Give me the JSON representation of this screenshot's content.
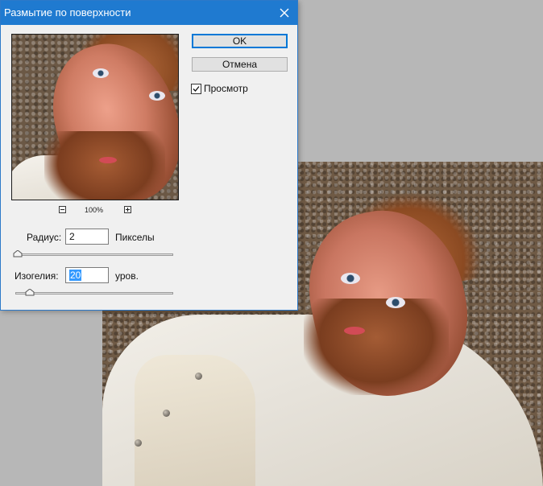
{
  "dialog": {
    "title": "Размытие по поверхности",
    "ok_label": "OK",
    "cancel_label": "Отмена",
    "preview_label": "Просмотр",
    "preview_checked": true,
    "zoom_level": "100%",
    "radius": {
      "label": "Радиус:",
      "value": "2",
      "unit": "Пикселы",
      "slider_fraction": 0.0
    },
    "threshold": {
      "label": "Изогелия:",
      "value": "20",
      "unit": "уров.",
      "slider_fraction": 0.08
    }
  },
  "icons": {
    "close": "close-icon",
    "zoom_out": "minus-icon",
    "zoom_in": "plus-icon",
    "check": "checkmark-icon"
  },
  "colors": {
    "titlebar": "#1f7ad0",
    "default_button_border": "#0078d7",
    "selection": "#3399ff"
  }
}
